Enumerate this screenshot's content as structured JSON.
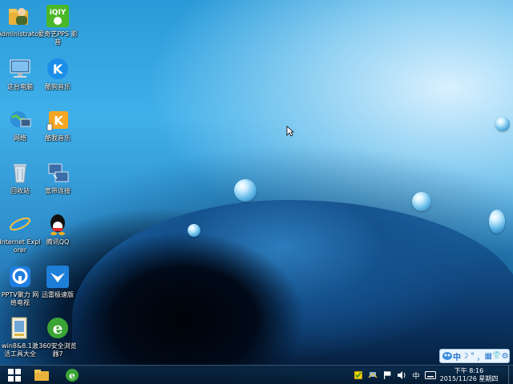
{
  "desktop": {
    "icons": [
      {
        "key": "admin",
        "label": "Administrator",
        "icon": "user-folder-icon"
      },
      {
        "key": "iqiyi",
        "label": "爱奇艺PPS 影音",
        "icon": "iqiyi-icon"
      },
      {
        "key": "computer",
        "label": "这台电脑",
        "icon": "computer-icon"
      },
      {
        "key": "kugou",
        "label": "酷狗音乐",
        "icon": "kugou-icon"
      },
      {
        "key": "network",
        "label": "网络",
        "icon": "network-icon"
      },
      {
        "key": "kuwo",
        "label": "酷我音乐",
        "icon": "kuwo-icon"
      },
      {
        "key": "recycle",
        "label": "回收站",
        "icon": "recycle-bin-icon"
      },
      {
        "key": "broadband",
        "label": "宽带连接",
        "icon": "broadband-icon"
      },
      {
        "key": "ie",
        "label": "Internet Explorer",
        "icon": "internet-explorer-icon"
      },
      {
        "key": "qq",
        "label": "腾讯QQ",
        "icon": "qq-icon"
      },
      {
        "key": "pptv",
        "label": "PPTV聚力 网络电视",
        "icon": "pptv-icon"
      },
      {
        "key": "xunlei",
        "label": "迅雷极速版",
        "icon": "xunlei-icon"
      },
      {
        "key": "win8tool",
        "label": "win8&8.1激活工具大全",
        "icon": "win8-tool-icon"
      },
      {
        "key": "browser360",
        "label": "360安全浏览器7",
        "icon": "browser-360-icon"
      }
    ]
  },
  "taskbar": {
    "start": "start-icon",
    "pinned": [
      "file-explorer-icon",
      "browser-360-icon"
    ],
    "tray_ime": "中",
    "clock_time": "下午 8:16",
    "clock_date": "2015/11/26 星期四"
  },
  "ime_bar": {
    "lang": "中",
    "moon": "☽",
    "dot": "°",
    "comma": "，",
    "grid": "▦",
    "shirt": "👕",
    "gear": "⚙"
  }
}
